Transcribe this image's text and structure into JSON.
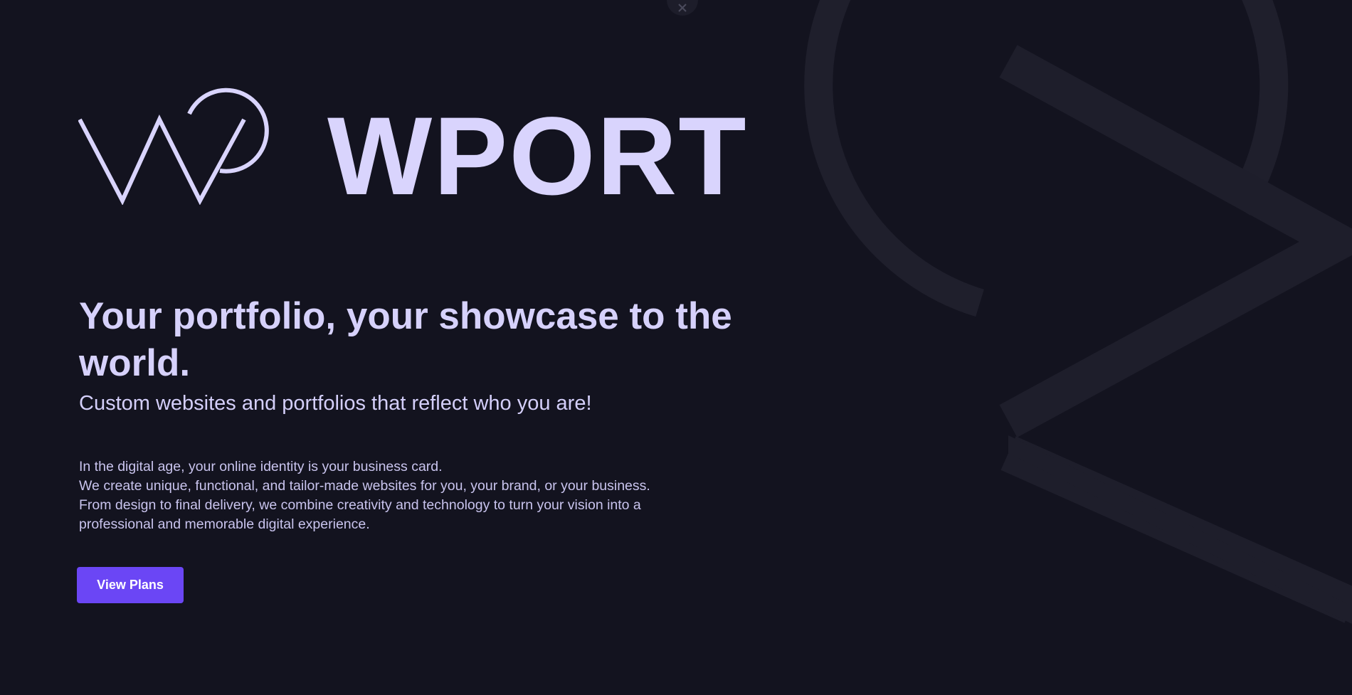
{
  "brand": {
    "name": "WPORT",
    "logo_icon": "wp-monogram-icon"
  },
  "hero": {
    "headline": "Your portfolio, your showcase to the world.",
    "subheadline": "Custom websites and portfolios that reflect who you are!",
    "description_lines": [
      "In the digital age, your online identity is your business card.",
      "We create unique, functional, and tailor-made websites for you, your brand, or your business.",
      "From design to final delivery, we combine creativity and technology to turn your vision into a",
      "professional and memorable digital experience."
    ],
    "cta_label": "View Plans"
  },
  "controls": {
    "close_icon": "close-icon"
  },
  "theme": {
    "background": "#13131f",
    "text": "#d4cffa",
    "accent": "#6b46f5",
    "decoration": "#1e1e2b"
  }
}
